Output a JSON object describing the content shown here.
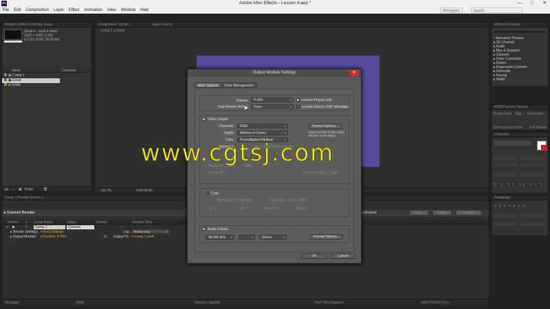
{
  "app": {
    "logo": "Ae",
    "title": "Adobe After Effects - Lesson 4.aep *"
  },
  "window_controls": [
    "—",
    "□",
    "✕"
  ],
  "menu": [
    "File",
    "Edit",
    "Composition",
    "Layer",
    "Effect",
    "Animation",
    "View",
    "Window",
    "Help"
  ],
  "workspace": {
    "current": "Workspace",
    "search": "Search"
  },
  "project": {
    "tabs": "Project ≡   Effect Controls: Great",
    "item_name": "Great ▾ , used 4 times",
    "item_info1": "1920 x 1080 (1.00)",
    "item_info2": "Δ 0:00:10:00, 30.00 fps",
    "col_name": "Name",
    "col_comment": "Comment",
    "items": [
      "Comp 1",
      "Great",
      "Solids"
    ],
    "bpc": "8 bpc"
  },
  "composition": {
    "tab": "Composition: Comp 1",
    "layer_tab": "Layer: (none)",
    "breadcrumb": [
      "Comp 1",
      "Great"
    ],
    "zoom": "50.7%",
    "time": "0:00:00:00",
    "solid_color": "#5a4a9c"
  },
  "effects": {
    "tab": "Effects & Presets",
    "items": [
      "* Animation Presets",
      "3D Channel",
      "Audio",
      "Blur & Sharpen",
      "Channel",
      "Color Correction",
      "Distort",
      "Expression Controls",
      "Generate",
      "Keying",
      "Matte"
    ]
  },
  "preview": {
    "tab": "RAM Preview Options",
    "frame_rate": "Frame Rate",
    "skip": "Skip",
    "resolution": "Resolution",
    "from_current": "From Current Time",
    "full_screen": "Full Screen"
  },
  "character": {
    "tab": "Character"
  },
  "paragraph": {
    "tab": "Paragraph"
  },
  "render_queue": {
    "tabs": "Comp 1   Render Queue ≡",
    "current_render": "Current Render",
    "estimated": "Estimated:",
    "stop": "Stop",
    "pause": "Pause",
    "render": "Render",
    "cols": [
      "Render",
      "#",
      "Comp Name",
      "Status",
      "Started",
      "Render Time"
    ],
    "item": {
      "num": "1",
      "name": "Comp 1",
      "status": "Queued"
    },
    "render_settings_label": "Render Settings:",
    "render_settings_value": "Best Settings",
    "log_label": "Log:",
    "log_value": "Errors Only",
    "output_module_label": "Output Module:",
    "output_module_value": "Custom: H.264",
    "output_to_label": "Output To:",
    "output_to_value": "Comp 1.mp4",
    "footer": [
      "Message:",
      "RAM:",
      "Renders Started:",
      "Total Time Elapsed:",
      "Most Recent Error:"
    ]
  },
  "dialog": {
    "title": "Output Module Settings",
    "tab_main": "Main Options",
    "tab_color": "Color Management",
    "format_label": "Format:",
    "format_value": "H.264",
    "include_project_link": "Include Project Link",
    "post_render_label": "Post-Render Action:",
    "post_render_value": "None",
    "include_xmp": "Include Source XMP Metadata",
    "video_output": "Video Output",
    "channels_label": "Channels:",
    "channels_value": "RGB",
    "format_options": "Format Options...",
    "depth_label": "Depth:",
    "depth_value": "Millions of Colors",
    "codec_info1": "MainConcept H.264 Video",
    "codec_info2": "Bitrate: 10.00 Mbps",
    "color_label": "Color:",
    "color_value": "Premultiplied (Matted)",
    "starting_label": "Starting #:",
    "use_comp_frame": "Use Comp Frame Number",
    "resize_to": "Resize to:",
    "resize_w": "1920",
    "resize_h": "1080",
    "resize_pct": "Resize %:",
    "resize_quality": "Resize Quality:",
    "resize_quality_value": "High",
    "crop": "Crop",
    "use_roi": "Use Region of Interest",
    "final_size": "Final Size: 1920 x 1080",
    "top": "Top:",
    "left": "Left:",
    "bottom": "Bottom:",
    "right": "Right:",
    "zero": "0",
    "audio_output": "Audio Output",
    "audio_rate": "48.000 kHz",
    "audio_channels": "Stereo",
    "audio_options": "Format Options...",
    "ok": "OK",
    "cancel": "Cancel"
  },
  "watermark": "www.cgtsj.com"
}
